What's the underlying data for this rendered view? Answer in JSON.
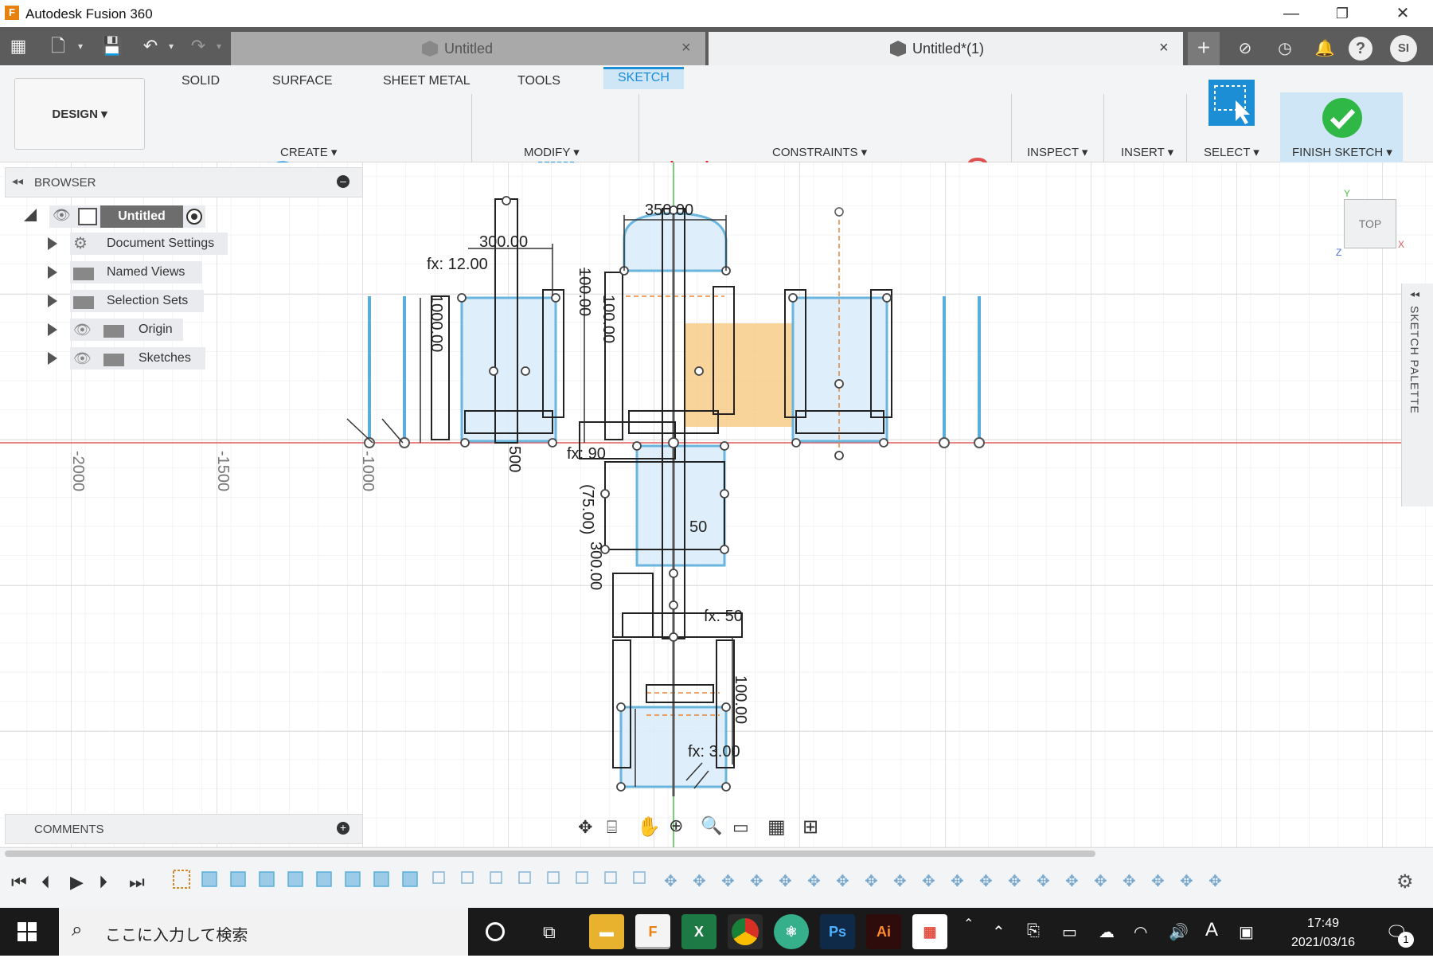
{
  "window": {
    "title": "Autodesk Fusion 360",
    "app_logo": "F",
    "minimize": "—",
    "restore": "❐",
    "close": "✕"
  },
  "tabs": [
    {
      "label": "Untitled",
      "close": "×"
    },
    {
      "label": "Untitled*(1)",
      "close": "×"
    }
  ],
  "user": {
    "initials": "SI"
  },
  "workspace": {
    "label": "DESIGN ▾"
  },
  "ribbon_tabs": [
    "SOLID",
    "SURFACE",
    "SHEET METAL",
    "TOOLS",
    "SKETCH"
  ],
  "ribbon_active": "SKETCH",
  "groups": {
    "create": "CREATE ▾",
    "modify": "MODIFY ▾",
    "constraints": "CONSTRAINTS ▾",
    "inspect": "INSPECT ▾",
    "insert": "INSERT ▾",
    "select": "SELECT ▾",
    "finish": "FINISH SKETCH ▾"
  },
  "browser": {
    "title": "BROWSER",
    "root": "Untitled",
    "items": [
      "Document Settings",
      "Named Views",
      "Selection Sets",
      "Origin",
      "Sketches"
    ]
  },
  "comments": {
    "title": "COMMENTS"
  },
  "viewcube": {
    "face": "TOP",
    "y_axis": "Y",
    "x_axis": "X",
    "z_axis": "Z"
  },
  "sketch_palette": {
    "title": "SKETCH PALETTE"
  },
  "axis_labels": [
    "-2000",
    "-1500",
    "-1000"
  ],
  "dimensions": [
    "350.00",
    "300.00",
    "fx: 12.00",
    "100.00",
    "1000.00",
    "100.00",
    "(75.00)",
    "300.00",
    "fx: 3.00",
    "100.00",
    "50",
    "fx: 50",
    "fx: 90",
    "500"
  ],
  "taskbar": {
    "search_placeholder": "ここに入力して検索",
    "time": "17:49",
    "date": "2021/03/16",
    "ime": "A",
    "notifications": "1"
  },
  "colors": {
    "accent": "#1b8ed6",
    "sketch_line": "#5aaedb",
    "x_axis": "#e35a5a",
    "y_axis": "#4bc24b",
    "selection_fill": "#f5c57a",
    "finish_green": "#2fb845"
  }
}
